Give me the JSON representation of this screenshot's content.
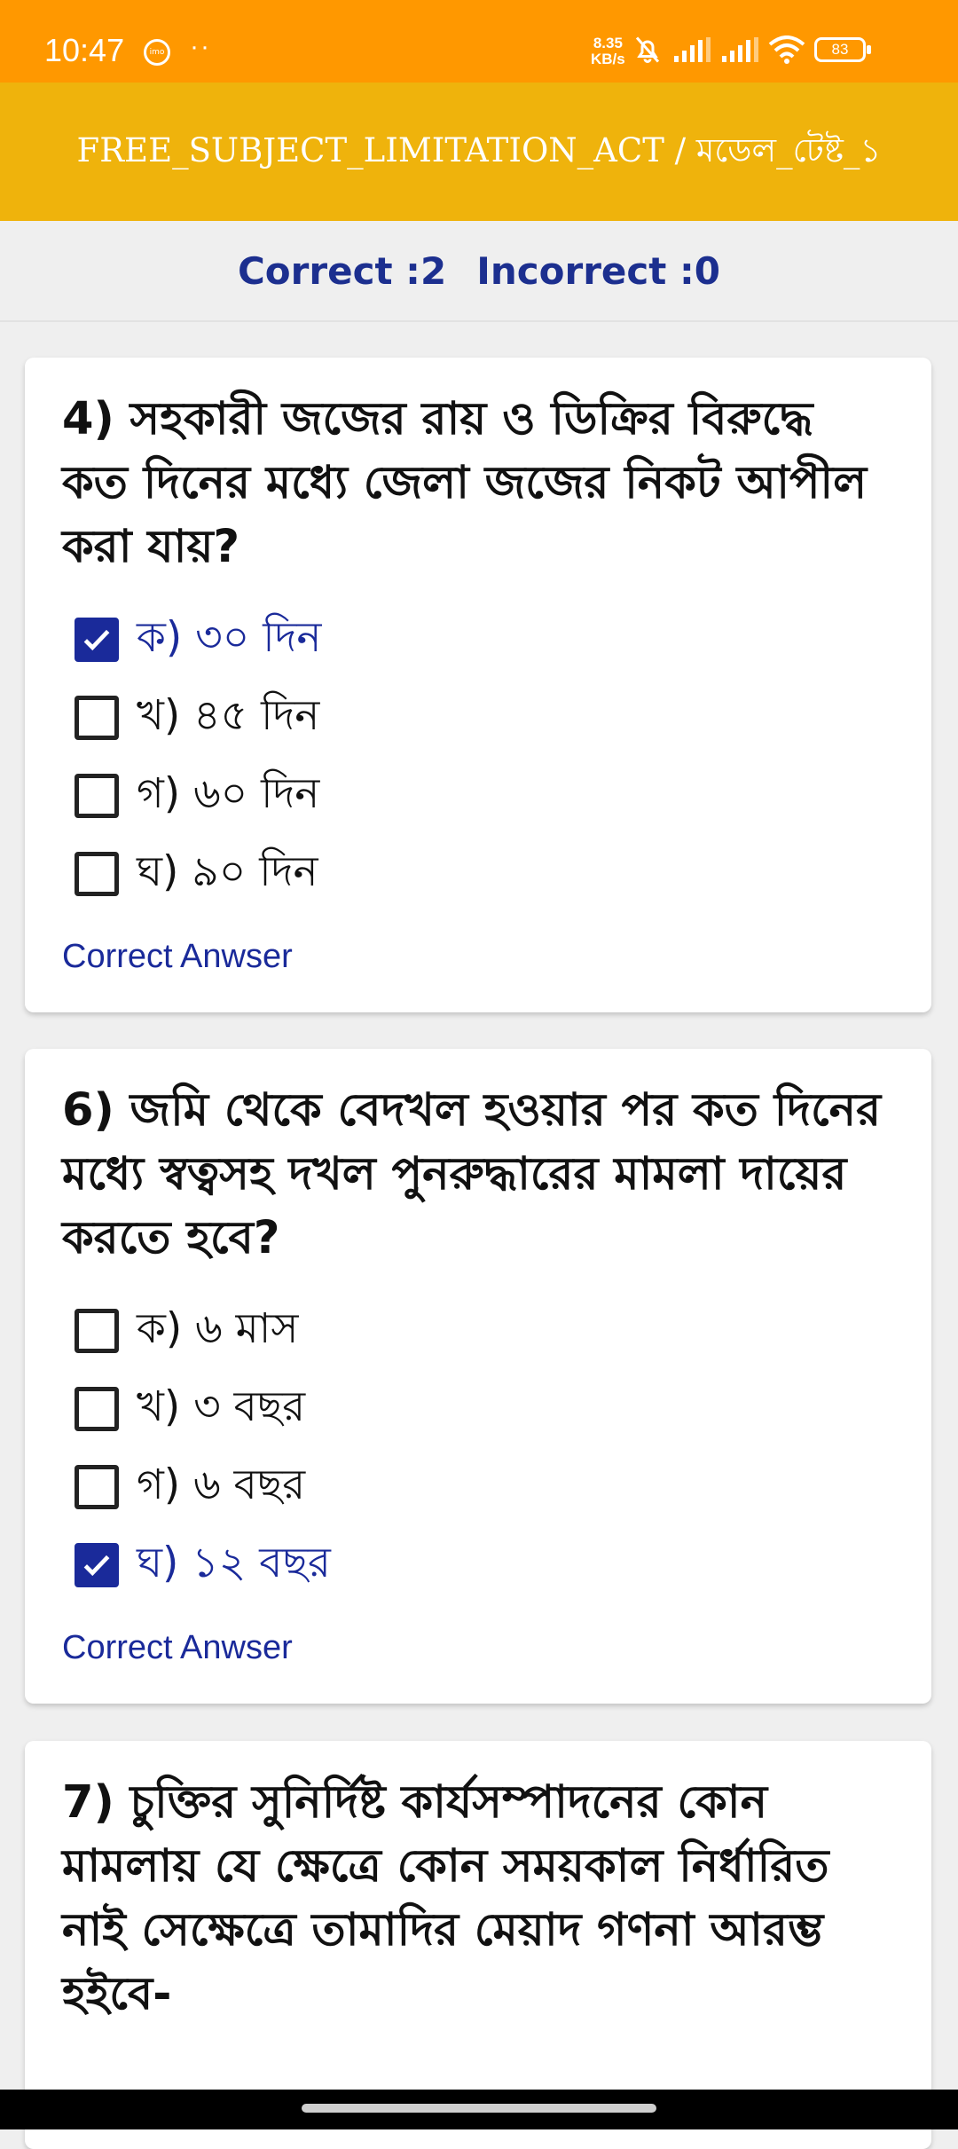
{
  "status_bar": {
    "time": "10:47",
    "notification_icons": [
      "imo-icon",
      "more-dots"
    ],
    "network_speed_value": "8.35",
    "network_speed_unit": "KB/s",
    "battery": "83"
  },
  "header": {
    "title": "FREE_SUBJECT_LIMITATION_ACT / মডেল_টেষ্ট_১"
  },
  "score": {
    "correct": "Correct :2",
    "incorrect": "Incorrect :0"
  },
  "questions": [
    {
      "text": "4) সহকারী জজের রায় ও ডিক্রির বিরুদ্ধে কত দিনের মধ্যে জেলা জজের নিকট আপীল করা যায়?",
      "options": [
        {
          "label": "ক) ৩০ দিন",
          "checked": true
        },
        {
          "label": "খ) ৪৫ দিন",
          "checked": false
        },
        {
          "label": "গ) ৬০ দিন",
          "checked": false
        },
        {
          "label": "ঘ) ৯০ দিন",
          "checked": false
        }
      ],
      "link": "Correct Anwser"
    },
    {
      "text": "6) জমি থেকে বেদখল হওয়ার পর কত দিনের মধ্যে স্বত্বসহ দখল পুনরুদ্ধারের মামলা দায়ের করতে হবে?",
      "options": [
        {
          "label": "ক) ৬ মাস",
          "checked": false
        },
        {
          "label": "খ) ৩ বছর",
          "checked": false
        },
        {
          "label": "গ) ৬ বছর",
          "checked": false
        },
        {
          "label": "ঘ) ১২ বছর",
          "checked": true
        }
      ],
      "link": "Correct Anwser"
    },
    {
      "text": "7) চুক্তির সুনির্দিষ্ট কার্যসম্পাদনের কোন মামলায় যে ক্ষেত্রে কোন সময়কাল নির্ধারিত নাই সেক্ষেত্রে তামাদির মেয়াদ গণনা আরম্ভ হইবে-"
    }
  ],
  "colors": {
    "status_bar": "#ff9800",
    "app_bar": "#efb30c",
    "accent": "#1a2a9a",
    "background": "#efefef"
  }
}
